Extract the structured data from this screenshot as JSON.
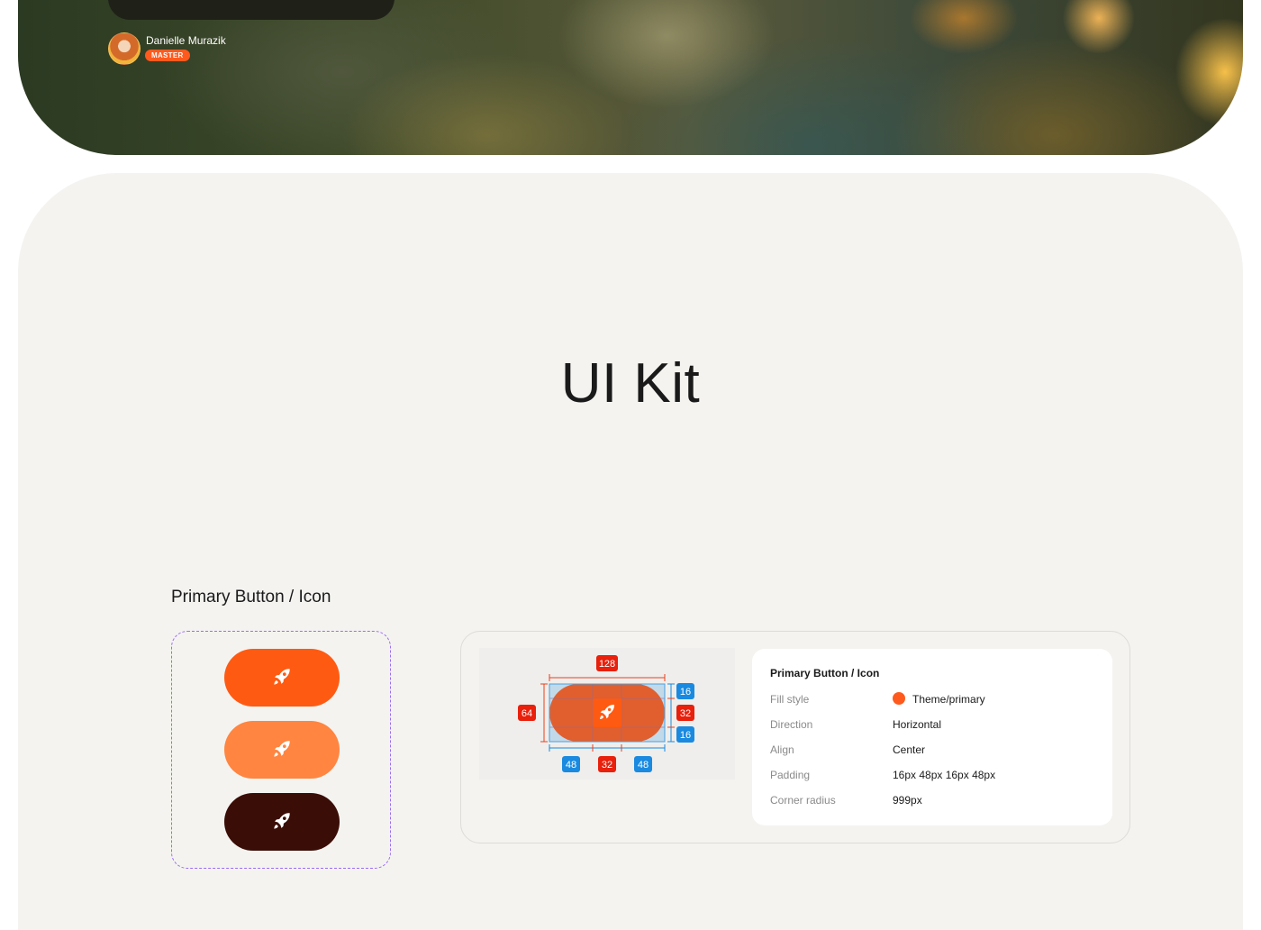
{
  "hero": {
    "author_name": "Danielle Murazik",
    "author_badge": "MASTER"
  },
  "page": {
    "title": "UI Kit",
    "section_label": "Primary Button / Icon"
  },
  "variants": [
    {
      "name": "default",
      "color": "#ff5a12"
    },
    {
      "name": "hover",
      "color": "#ff8540"
    },
    {
      "name": "dark",
      "color": "#3a0d06"
    }
  ],
  "diagram": {
    "width": "128",
    "height": "64",
    "padding_top": "16",
    "icon_height": "32",
    "padding_bottom": "16",
    "padding_left": "48",
    "icon_width": "32",
    "padding_right": "48"
  },
  "spec": {
    "title": "Primary Button / Icon",
    "rows": [
      {
        "label": "Fill style",
        "value": "Theme/primary",
        "swatch": "#ff5a1e"
      },
      {
        "label": "Direction",
        "value": "Horizontal"
      },
      {
        "label": "Align",
        "value": "Center"
      },
      {
        "label": "Padding",
        "value": "16px 48px 16px 48px"
      },
      {
        "label": "Corner radius",
        "value": "999px"
      }
    ]
  },
  "icons": {
    "button_icon": "rocket-icon"
  }
}
